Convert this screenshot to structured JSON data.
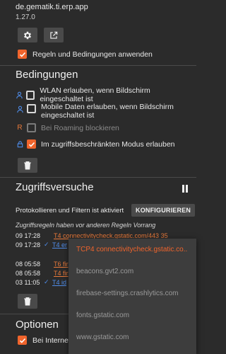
{
  "app": {
    "package": "de.gematik.ti.erp.app",
    "version": "1.27.0"
  },
  "header_buttons": [
    {
      "name": "settings-button",
      "icon": "gear-icon"
    },
    {
      "name": "open-external-button",
      "icon": "open-external-icon"
    }
  ],
  "apply_rules": {
    "label": "Regeln und Bedingungen anwenden",
    "checked": true
  },
  "conditions": {
    "title": "Bedingungen",
    "items": [
      {
        "icon": "person-icon",
        "label": "WLAN erlauben, wenn Bildschirm eingeschaltet ist",
        "state": "off"
      },
      {
        "icon": "person-icon",
        "label": "Mobile Daten erlauben, wenn Bildschirm eingeschaltet ist",
        "state": "off"
      },
      {
        "icon": "roaming-icon",
        "icon_text": "R",
        "label": "Bei Roaming blockieren",
        "state": "disabled"
      },
      {
        "icon": "lock-icon",
        "label": "Im zugriffsbeschränkten Modus erlauben",
        "state": "on"
      }
    ]
  },
  "access": {
    "title": "Zugriffsversuche",
    "filter_text": "Protokollieren und Filtern ist aktiviert",
    "configure_label": "KONFIGURIEREN",
    "note": "Zugriffsregeln haben vor anderen Regeln Vorrang",
    "log": [
      {
        "time": "09 17:28",
        "dest": "T4 connectivitycheck.gstatic.com/443 35",
        "status": "blocked",
        "check": ""
      },
      {
        "time": "09 17:28",
        "dest": "T4 er",
        "status": "allowed",
        "check": "✓"
      },
      {
        "time": "08 05:58",
        "dest": "T6 fir",
        "status": "blocked",
        "check": ""
      },
      {
        "time": "08 05:58",
        "dest": "T4 fir",
        "status": "blocked",
        "check": ""
      },
      {
        "time": "03 11:05",
        "dest": "T4 id",
        "status": "allowed",
        "check": "✓"
      }
    ]
  },
  "options": {
    "title": "Optionen",
    "first_item": {
      "label": "Bei Internetz",
      "checked": true
    }
  },
  "popup": {
    "items": [
      "TCP4 connectivitycheck.gstatic.co..",
      "beacons.gvt2.com",
      "firebase-settings.crashlytics.com",
      "fonts.gstatic.com",
      "www.gstatic.com"
    ]
  },
  "colors": {
    "accent": "#f0642c",
    "link_blue": "#4f8ce8",
    "background": "#2b2b2b"
  }
}
